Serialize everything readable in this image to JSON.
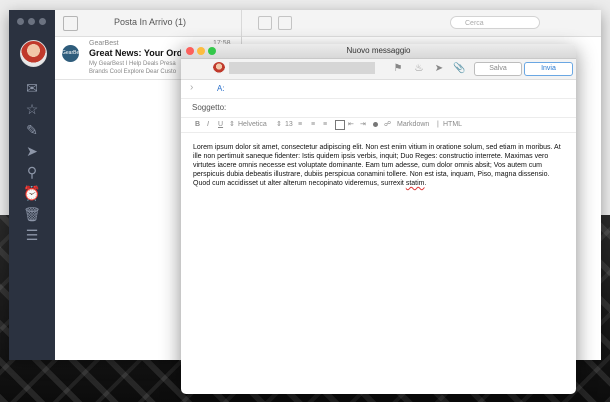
{
  "mail_list": {
    "title": "Posta In Arrivo (1)",
    "items": [
      {
        "sender": "GearBest",
        "time": "17:58",
        "subject": "Great News: Your Orde",
        "preview_line1": "My GearBest I Help Deals Presa",
        "preview_line2": "Brands Cool Explore Dear Custo",
        "logo_text": "GearBest"
      }
    ]
  },
  "reading_toolbar": {
    "search_placeholder": "Cerca"
  },
  "compose": {
    "window_title": "Nuovo messaggio",
    "save_label": "Salva",
    "send_label": "Invia",
    "to_label": "A:",
    "subject_label": "Soggetto:",
    "format": {
      "bold": "B",
      "italic": "I",
      "underline": "U",
      "font": "Helvetica",
      "size": "13",
      "markdown": "Markdown",
      "html": "HTML"
    },
    "body_before_typo": "Lorem ipsum dolor sit amet, consectetur adipiscing elit. Non est enim vitium in oratione solum, sed etiam in moribus. At ille non pertimuit saneque fidenter: Istis quidem ipsis verbis, inquit; Duo Reges: constructio interrete. Maximas vero virtutes iacere omnis necesse est voluptate dominante. Eam tum adesse, cum dolor omnis absit; Vos autem cum perspicuis dubia debeatis illustrare, dubiis perspicua conamini tollere. Non est ista, inquam, Piso, magna dissensio. Quod cum accidisset ut alter alterum necopinato videremus, surrexit ",
    "body_typo": "statim",
    "body_after_typo": "."
  },
  "colors": {
    "sidebar": "#2b3240",
    "close": "#fc605c",
    "minimize": "#fdbc40",
    "zoom": "#34c84a",
    "send_accent": "#2a7ad1"
  }
}
